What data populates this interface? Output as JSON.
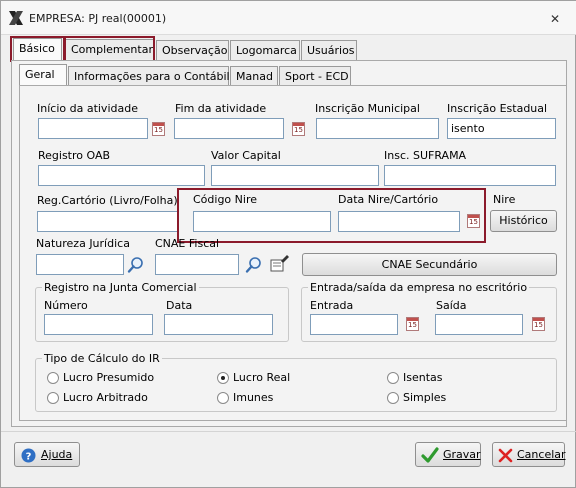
{
  "window": {
    "title": "EMPRESA: PJ real(00001)",
    "close_symbol": "✕"
  },
  "main_tabs": [
    {
      "label": "Básico"
    },
    {
      "label": "Complementar"
    },
    {
      "label": "Observação"
    },
    {
      "label": "Logomarca"
    },
    {
      "label": "Usuários"
    }
  ],
  "sub_tabs": [
    {
      "label": "Geral"
    },
    {
      "label": "Informações para o Contábil"
    },
    {
      "label": "Manad"
    },
    {
      "label": "Sport - ECD"
    }
  ],
  "fields": {
    "inicio_atividade": {
      "label": "Início da atividade",
      "value": ""
    },
    "fim_atividade": {
      "label": "Fim da atividade",
      "value": ""
    },
    "inscricao_municipal": {
      "label": "Inscrição Municipal",
      "value": ""
    },
    "inscricao_estadual": {
      "label": "Inscrição Estadual",
      "value": "isento"
    },
    "registro_oab": {
      "label": "Registro OAB",
      "value": ""
    },
    "valor_capital": {
      "label": "Valor Capital",
      "value": ""
    },
    "insc_suframa": {
      "label": "Insc. SUFRAMA",
      "value": ""
    },
    "reg_cartorio": {
      "label": "Reg.Cartório (Livro/Folha)",
      "value": ""
    },
    "codigo_nire": {
      "label": "Código Nire",
      "value": ""
    },
    "data_nire": {
      "label": "Data Nire/Cartório",
      "value": ""
    },
    "nire": {
      "label": "Nire"
    },
    "natureza_juridica": {
      "label": "Natureza Jurídica",
      "value": ""
    },
    "cnae_fiscal": {
      "label": "CNAE Fiscal",
      "value": ""
    }
  },
  "buttons": {
    "historico": "Histórico",
    "cnae_secundario": "CNAE Secundário",
    "ajuda": "Ajuda",
    "gravar": "Gravar",
    "cancelar": "Cancelar"
  },
  "calendar_text": "15",
  "registro_junta": {
    "title": "Registro na Junta Comercial",
    "numero_label": "Número",
    "data_label": "Data"
  },
  "entrada_saida": {
    "title": "Entrada/saída da empresa no escritório",
    "entrada_label": "Entrada",
    "saida_label": "Saída"
  },
  "tipo_calculo": {
    "title": "Tipo de Cálculo do IR",
    "options": [
      {
        "label": "Lucro Presumido",
        "selected": false
      },
      {
        "label": "Lucro Real",
        "selected": true
      },
      {
        "label": "Isentas",
        "selected": false
      },
      {
        "label": "Lucro Arbitrado",
        "selected": false
      },
      {
        "label": "Imunes",
        "selected": false
      },
      {
        "label": "Simples",
        "selected": false
      }
    ]
  },
  "colors": {
    "highlight": "#8b1a2b",
    "accent_green": "#2e9a2e",
    "accent_red": "#d22"
  }
}
